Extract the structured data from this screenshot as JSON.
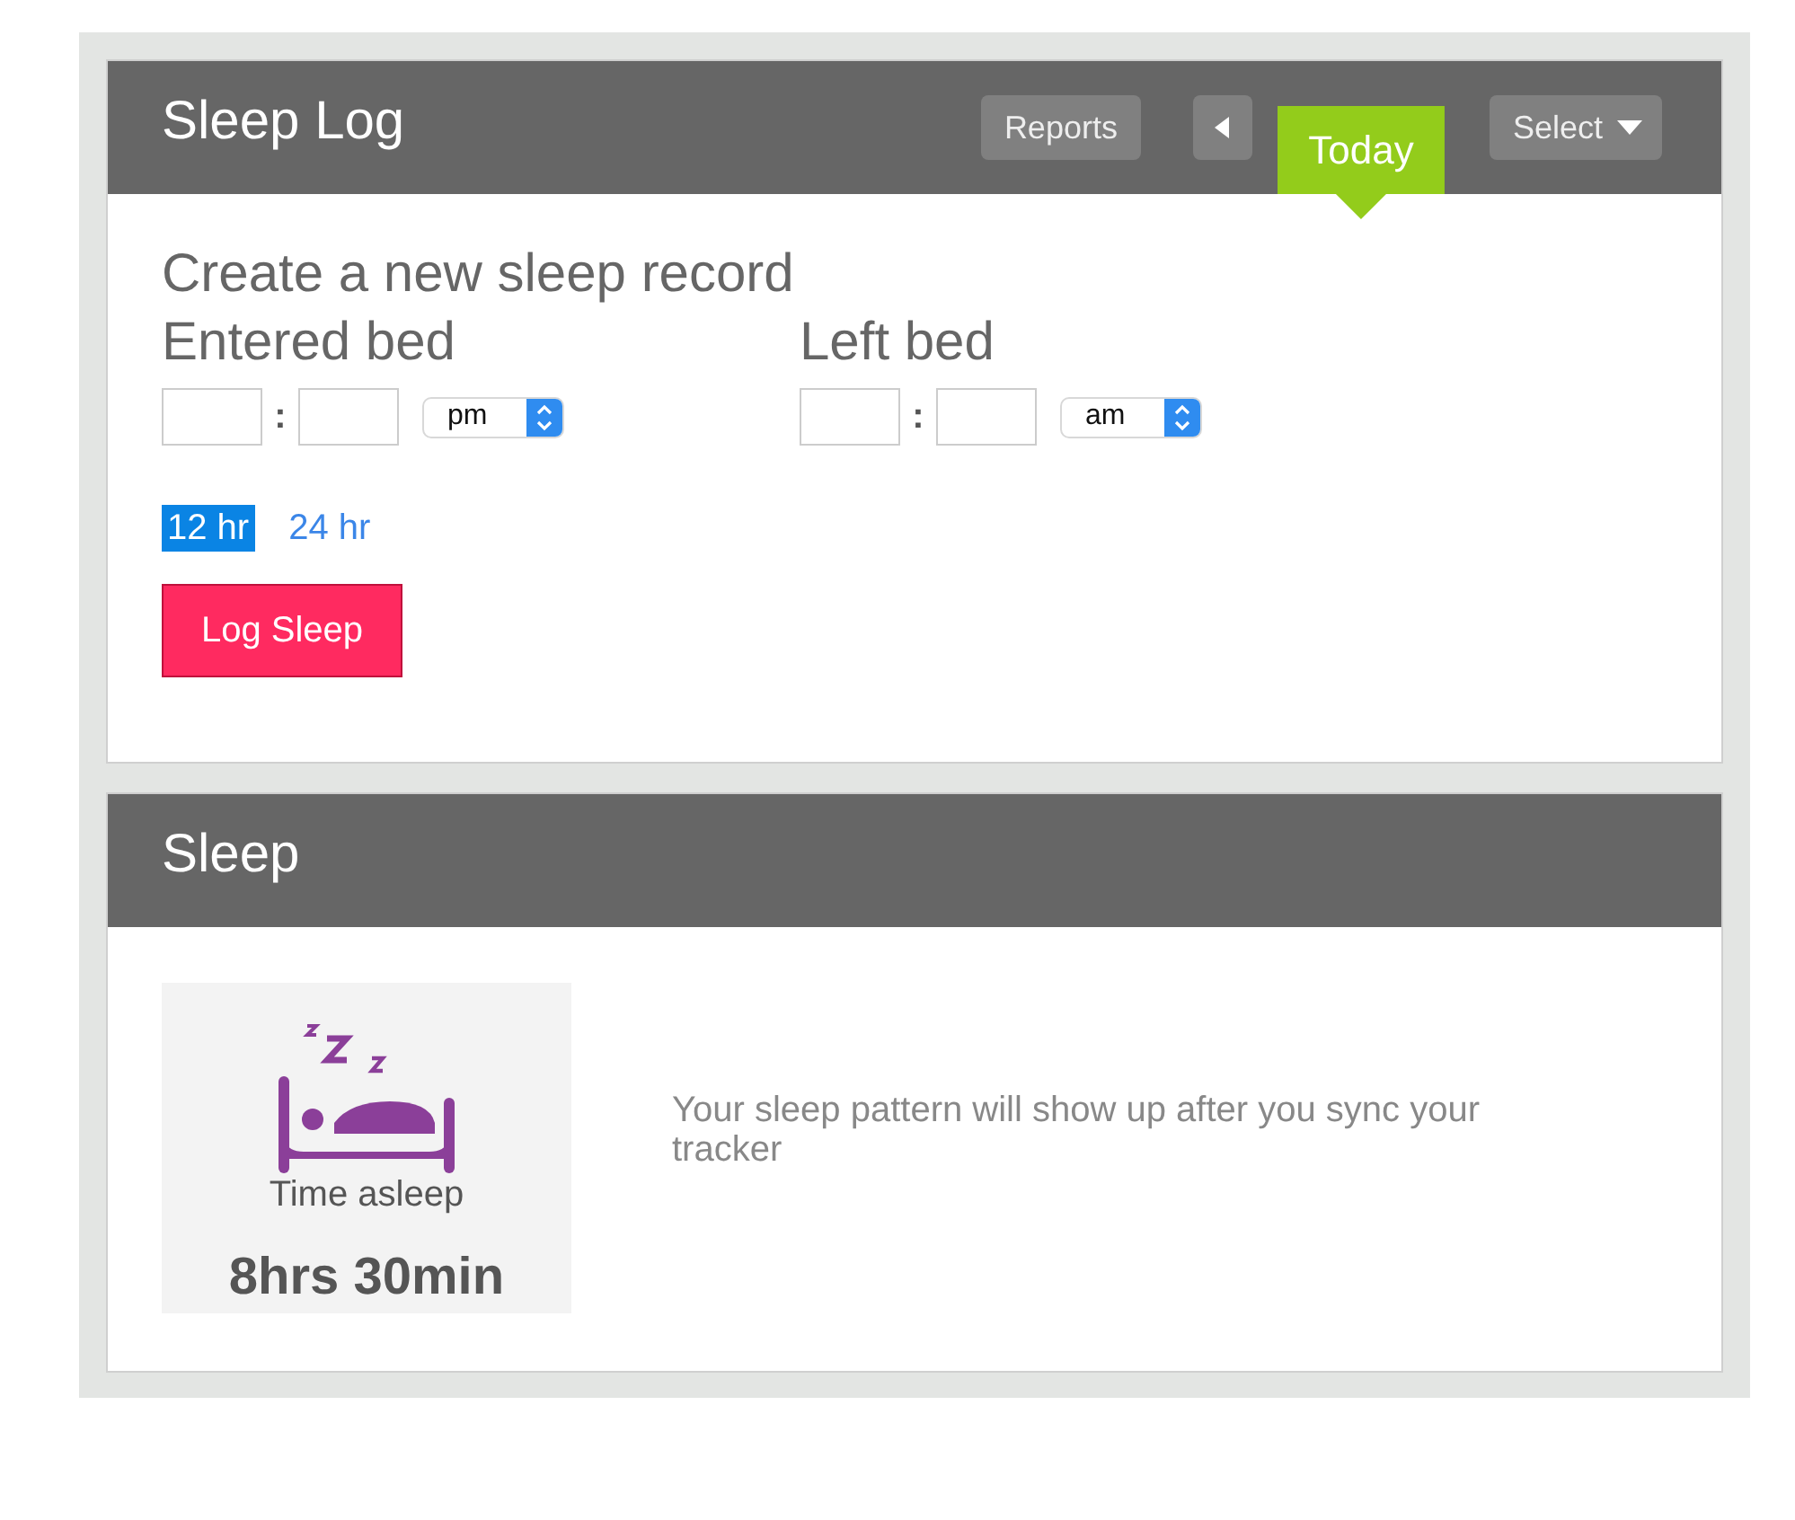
{
  "sleep_log": {
    "title": "Sleep Log",
    "toolbar": [
      {
        "kind": "button",
        "label": "Reports"
      },
      {
        "kind": "prev"
      },
      {
        "kind": "tab",
        "label": "Today",
        "selected": true
      },
      {
        "kind": "dropdown",
        "label": "Select"
      }
    ]
  },
  "form": {
    "heading": "Create a new sleep record",
    "times": [
      {
        "label": "Entered bed",
        "separator": ":",
        "period": "pm"
      },
      {
        "label": "Left bed",
        "separator": ":",
        "period": "am"
      }
    ],
    "formats": [
      {
        "label": "12 hr",
        "selected": true
      },
      {
        "label": "24 hr",
        "selected": false
      }
    ],
    "submit_button": "Log Sleep"
  },
  "sleep": {
    "title": "Sleep",
    "summary": {
      "label": "Time asleep",
      "value": "8hrs 30min"
    },
    "message": "Your sleep pattern will show up after you sync your tracker"
  }
}
